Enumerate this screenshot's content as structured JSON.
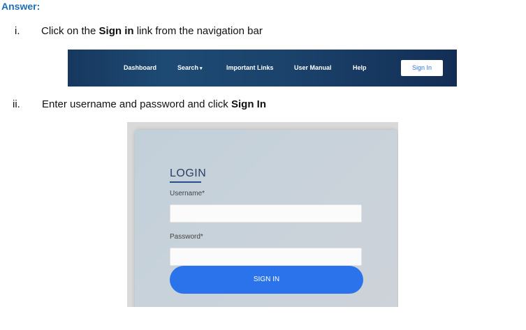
{
  "heading": "Answer:",
  "steps": [
    {
      "num": "i.",
      "pre": "Click on the ",
      "bold": "Sign in",
      "post": " link from the navigation bar"
    },
    {
      "num": "ii.",
      "pre": "Enter username and password and click ",
      "bold": "Sign In",
      "post": ""
    }
  ],
  "navbar": {
    "items": [
      "Dashboard",
      "Search",
      "Important Links",
      "User Manual",
      "Help"
    ],
    "caret": "▾",
    "signin_label": "Sign In"
  },
  "login": {
    "title": "LOGIN",
    "username_label": "Username*",
    "password_label": "Password*",
    "button_label": "SIGN IN"
  }
}
